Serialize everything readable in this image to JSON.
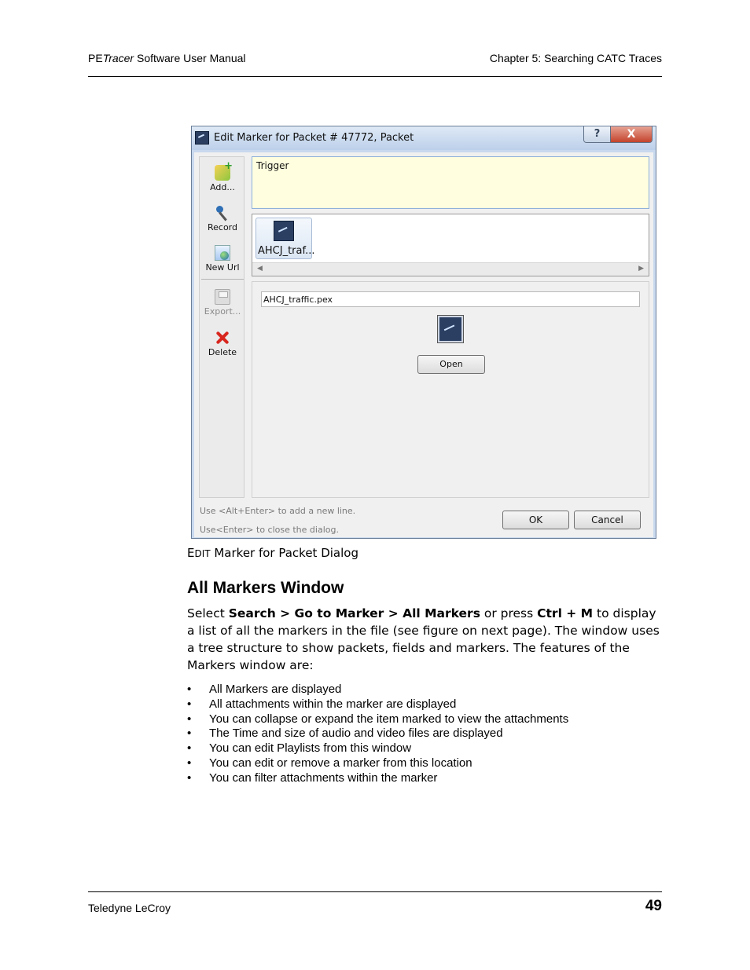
{
  "header": {
    "product_prefix": "PE",
    "product_italic": "Tracer",
    "product_suffix": " Software User Manual",
    "chapter": "Chapter 5: Searching CATC Traces"
  },
  "dialog": {
    "title": "Edit Marker for Packet # 47772, Packet",
    "help_glyph": "?",
    "close_glyph": "X",
    "toolbar": {
      "add": "Add...",
      "record": "Record",
      "new_url": "New Url",
      "export": "Export...",
      "delete": "Delete"
    },
    "comment_text": "Trigger",
    "attachment_label": "AHCJ_traf...",
    "filename": "AHCJ_traffic.pex",
    "open_button": "Open",
    "hint_1": "Use <Alt+Enter> to add a new line.",
    "hint_2": "Use<Enter> to close the dialog.",
    "ok_button": "OK",
    "cancel_button": "Cancel"
  },
  "caption": {
    "first_letter": "E",
    "small_caps": "DIT",
    "rest": " Marker for Packet Dialog"
  },
  "section": {
    "heading": "All Markers Window",
    "para": {
      "t1": "Select ",
      "b1": "Search > Go to Marker > All Markers",
      "t2": " or press ",
      "b2": "Ctrl + M",
      "t3": " to display a list of all the markers in the file (see figure on next page). The window uses a tree structure to show packets, fields and markers. The features of the Markers window are:"
    },
    "bullets": [
      "All Markers are displayed",
      "All attachments within the marker are displayed",
      "You can collapse or expand the item marked to view the attachments",
      "The Time and size of audio and video files are displayed",
      "You can edit Playlists from this window",
      "You can edit or remove a marker from this location",
      "You can filter attachments within the marker"
    ]
  },
  "footer": {
    "company": "Teledyne LeCroy",
    "page_number": "49"
  }
}
